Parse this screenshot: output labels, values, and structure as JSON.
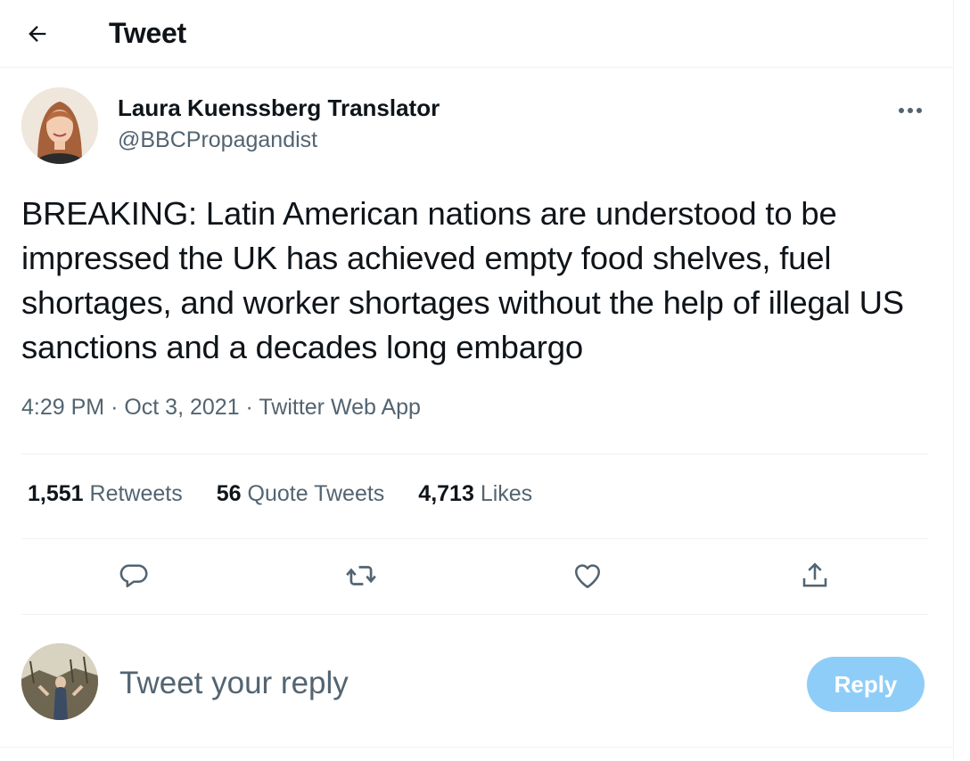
{
  "header": {
    "back_icon": "arrow-left-icon",
    "title": "Tweet"
  },
  "author": {
    "name": "Laura Kuenssberg Translator",
    "handle": "@BBCPropagandist"
  },
  "tweet": {
    "text": "BREAKING: Latin American nations are understood to be impressed the UK has achieved empty food shelves, fuel shortages, and worker shortages without the help of illegal US sanctions and a decades long embargo",
    "time": "4:29 PM",
    "date": "Oct 3, 2021",
    "source": "Twitter Web App",
    "separator": "·"
  },
  "stats": {
    "retweets_count": "1,551",
    "retweets_label": "Retweets",
    "quotes_count": "56",
    "quotes_label": "Quote Tweets",
    "likes_count": "4,713",
    "likes_label": "Likes"
  },
  "actions": [
    "reply-icon",
    "retweet-icon",
    "like-icon",
    "share-icon"
  ],
  "reply_box": {
    "placeholder": "Tweet your reply",
    "button_label": "Reply"
  },
  "colors": {
    "text": "#0f1419",
    "muted": "#536471",
    "border": "#eff3f4",
    "reply_button_disabled": "#8ecdf8"
  }
}
